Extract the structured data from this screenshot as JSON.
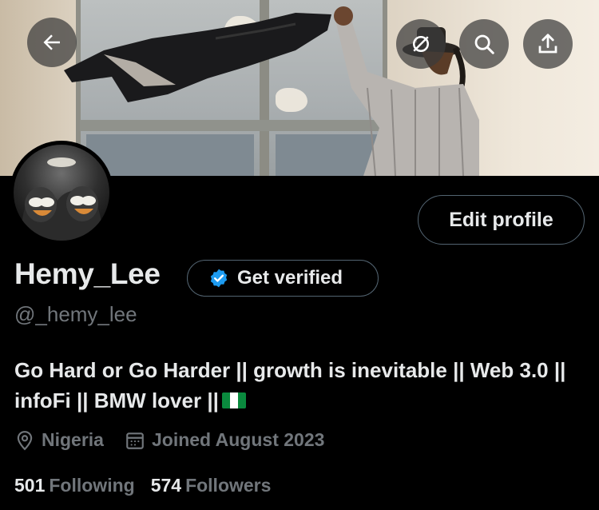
{
  "header": {
    "back_icon": "arrow-left-icon",
    "grok_icon": "grok-icon",
    "search_icon": "search-icon",
    "share_icon": "share-icon"
  },
  "profile": {
    "display_name": "Hemy_Lee",
    "handle": "@_hemy_lee",
    "edit_label": "Edit profile",
    "verify_label": "Get verified",
    "bio_text": "Go Hard or Go Harder || growth is inevitable || Web 3.0 || infoFi || BMW lover ||",
    "bio_flag": "nigeria-flag",
    "location": "Nigeria",
    "joined": "Joined August 2023",
    "following_count": "501",
    "following_label": "Following",
    "followers_count": "574",
    "followers_label": "Followers"
  },
  "colors": {
    "background": "#000000",
    "text_primary": "#e7e9ea",
    "text_secondary": "#71767b",
    "border": "#536471",
    "verified_blue": "#1d9bf0"
  }
}
